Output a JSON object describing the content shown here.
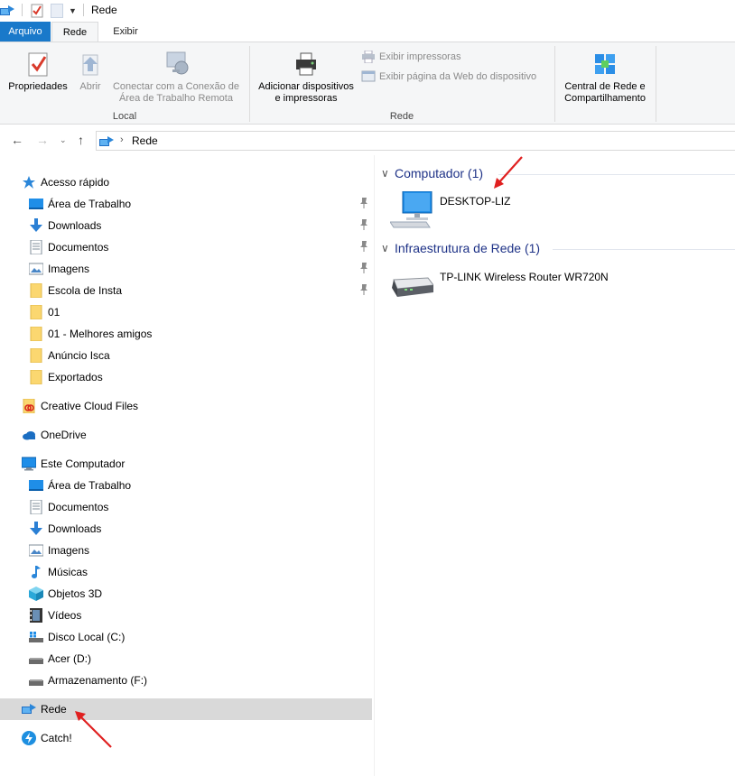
{
  "window": {
    "title": "Rede"
  },
  "tabs": [
    {
      "label": "Arquivo"
    },
    {
      "label": "Rede"
    },
    {
      "label": "Exibir"
    }
  ],
  "ribbon": {
    "local_group": {
      "label": "Local",
      "properties": "Propriedades",
      "open": "Abrir",
      "remote_line1": "Conectar com a Conexão de",
      "remote_line2": "Área de Trabalho Remota"
    },
    "network_group": {
      "label": "Rede",
      "add_line1": "Adicionar dispositivos",
      "add_line2": "e impressoras",
      "view_printers": "Exibir impressoras",
      "view_webpage": "Exibir página da Web do dispositivo"
    },
    "center": {
      "line1": "Central de Rede e",
      "line2": "Compartilhamento"
    }
  },
  "address": {
    "crumb": "Rede"
  },
  "sidebar": {
    "quick_access": "Acesso rápido",
    "quick_items": [
      {
        "label": "Área de Trabalho",
        "icon": "desktop-icon",
        "pinned": true
      },
      {
        "label": "Downloads",
        "icon": "download-icon",
        "pinned": true
      },
      {
        "label": "Documentos",
        "icon": "document-icon",
        "pinned": true
      },
      {
        "label": "Imagens",
        "icon": "image-icon",
        "pinned": true
      },
      {
        "label": "Escola de Insta",
        "icon": "folder-icon",
        "pinned": true
      },
      {
        "label": "01",
        "icon": "folder-icon",
        "pinned": false
      },
      {
        "label": "01 - Melhores amigos",
        "icon": "folder-icon",
        "pinned": false
      },
      {
        "label": "Anúncio Isca",
        "icon": "folder-icon",
        "pinned": false
      },
      {
        "label": "Exportados",
        "icon": "folder-icon",
        "pinned": false
      }
    ],
    "creative_cloud": "Creative Cloud Files",
    "onedrive": "OneDrive",
    "this_pc": "Este Computador",
    "pc_items": [
      {
        "label": "Área de Trabalho",
        "icon": "desktop-icon"
      },
      {
        "label": "Documentos",
        "icon": "document-icon"
      },
      {
        "label": "Downloads",
        "icon": "download-icon"
      },
      {
        "label": "Imagens",
        "icon": "image-icon"
      },
      {
        "label": "Músicas",
        "icon": "music-icon"
      },
      {
        "label": "Objetos 3D",
        "icon": "cube-icon"
      },
      {
        "label": "Vídeos",
        "icon": "video-icon"
      },
      {
        "label": "Disco Local (C:)",
        "icon": "system-drive-icon"
      },
      {
        "label": "Acer (D:)",
        "icon": "drive-icon"
      },
      {
        "label": "Armazenamento (F:)",
        "icon": "drive-icon"
      }
    ],
    "network": "Rede",
    "catch": "Catch!"
  },
  "content": {
    "groups": [
      {
        "header": "Computador (1)",
        "items": [
          {
            "name": "DESKTOP-LIZ",
            "icon": "computer-icon"
          }
        ]
      },
      {
        "header": "Infraestrutura de Rede (1)",
        "items": [
          {
            "name": "TP-LINK Wireless Router WR720N",
            "icon": "router-icon"
          }
        ]
      }
    ]
  },
  "colors": {
    "accent": "#1979ca",
    "group_header": "#1e3287",
    "selection": "#d9d9d9",
    "annotation_arrow": "#e02020"
  }
}
